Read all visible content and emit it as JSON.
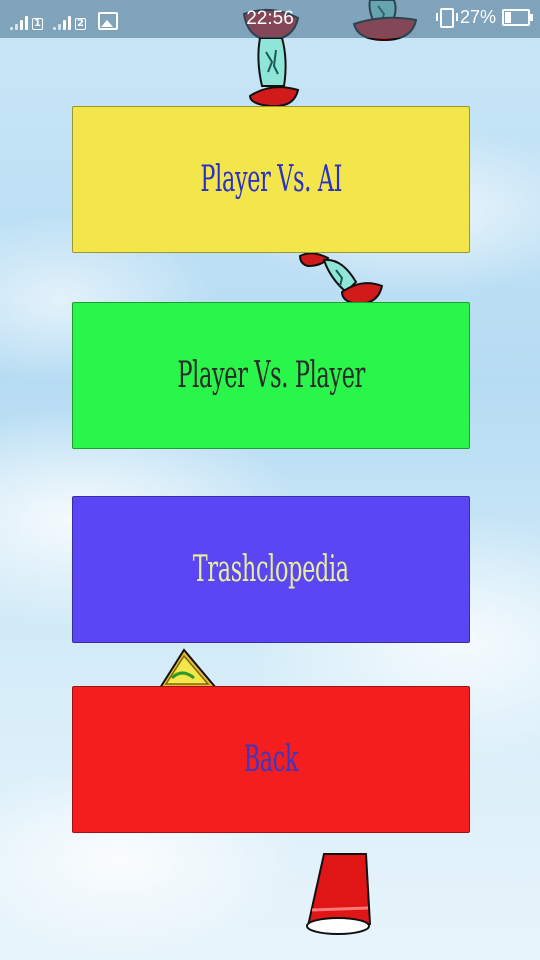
{
  "status_bar": {
    "sim1_label": "1",
    "sim2_label": "2",
    "time": "22:56",
    "battery_percent": "27%",
    "icons": [
      "signal-icon",
      "signal-icon",
      "gallery-icon",
      "vibrate-icon",
      "battery-icon"
    ]
  },
  "menu": {
    "buttons": [
      {
        "label": "Player Vs. AI",
        "bg_color": "#f3e64a",
        "text_color": "#2b30c9"
      },
      {
        "label": "Player Vs. Player",
        "bg_color": "#29f54b",
        "text_color": "#2a2a2a"
      },
      {
        "label": "Trashclopedia",
        "bg_color": "#5a46f5",
        "text_color": "#e6ef9a"
      },
      {
        "label": "Back",
        "bg_color": "#f41e1e",
        "text_color": "#3a36c6"
      }
    ]
  },
  "decorations": [
    "apple-core-icon",
    "apple-core-icon",
    "apple-core-icon",
    "sandwich-icon",
    "red-cup-icon"
  ]
}
